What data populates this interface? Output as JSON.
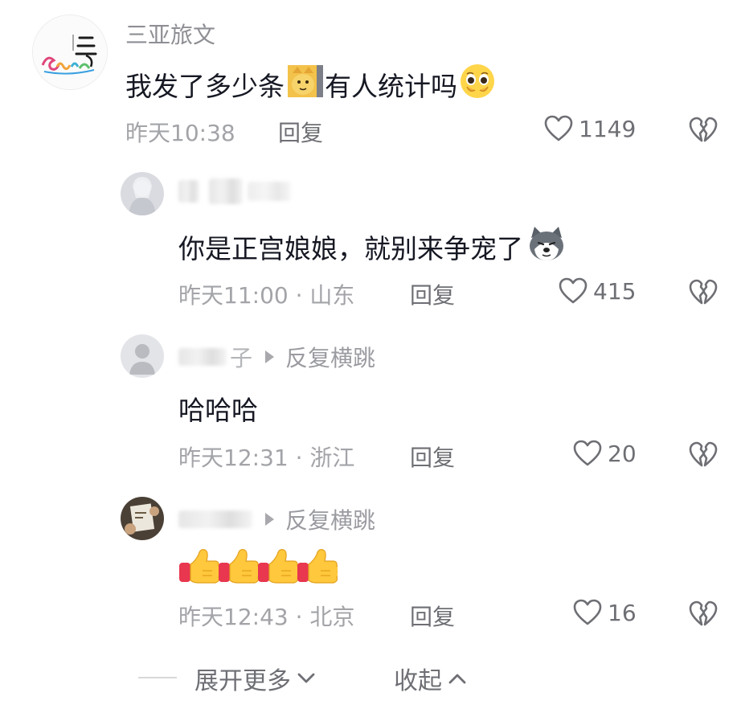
{
  "comments": [
    {
      "username": "三亚旅文",
      "text_parts": [
        "我发了多少条",
        "有人统计吗"
      ],
      "time": "昨天10:38",
      "reply_label": "回复",
      "likes": "1149"
    },
    {
      "username_blurred": true,
      "text": "你是正宫娘娘，就别来争宠了",
      "time": "昨天11:00",
      "location": "山东",
      "reply_label": "回复",
      "likes": "415"
    },
    {
      "username_visible": "子",
      "reply_to": "反复横跳",
      "text": "哈哈哈",
      "time": "昨天12:31",
      "location": "浙江",
      "reply_label": "回复",
      "likes": "20"
    },
    {
      "username_visible": "",
      "reply_to": "反复横跳",
      "emoji": "thumbs-up-x4",
      "time": "昨天12:43",
      "location": "北京",
      "reply_label": "回复",
      "likes": "16"
    }
  ],
  "separator": " · ",
  "footer": {
    "expand_label": "展开更多",
    "collapse_label": "收起"
  },
  "colors": {
    "text_primary": "#161823",
    "text_secondary": "#a3a4a8",
    "action": "#6e6f74"
  }
}
